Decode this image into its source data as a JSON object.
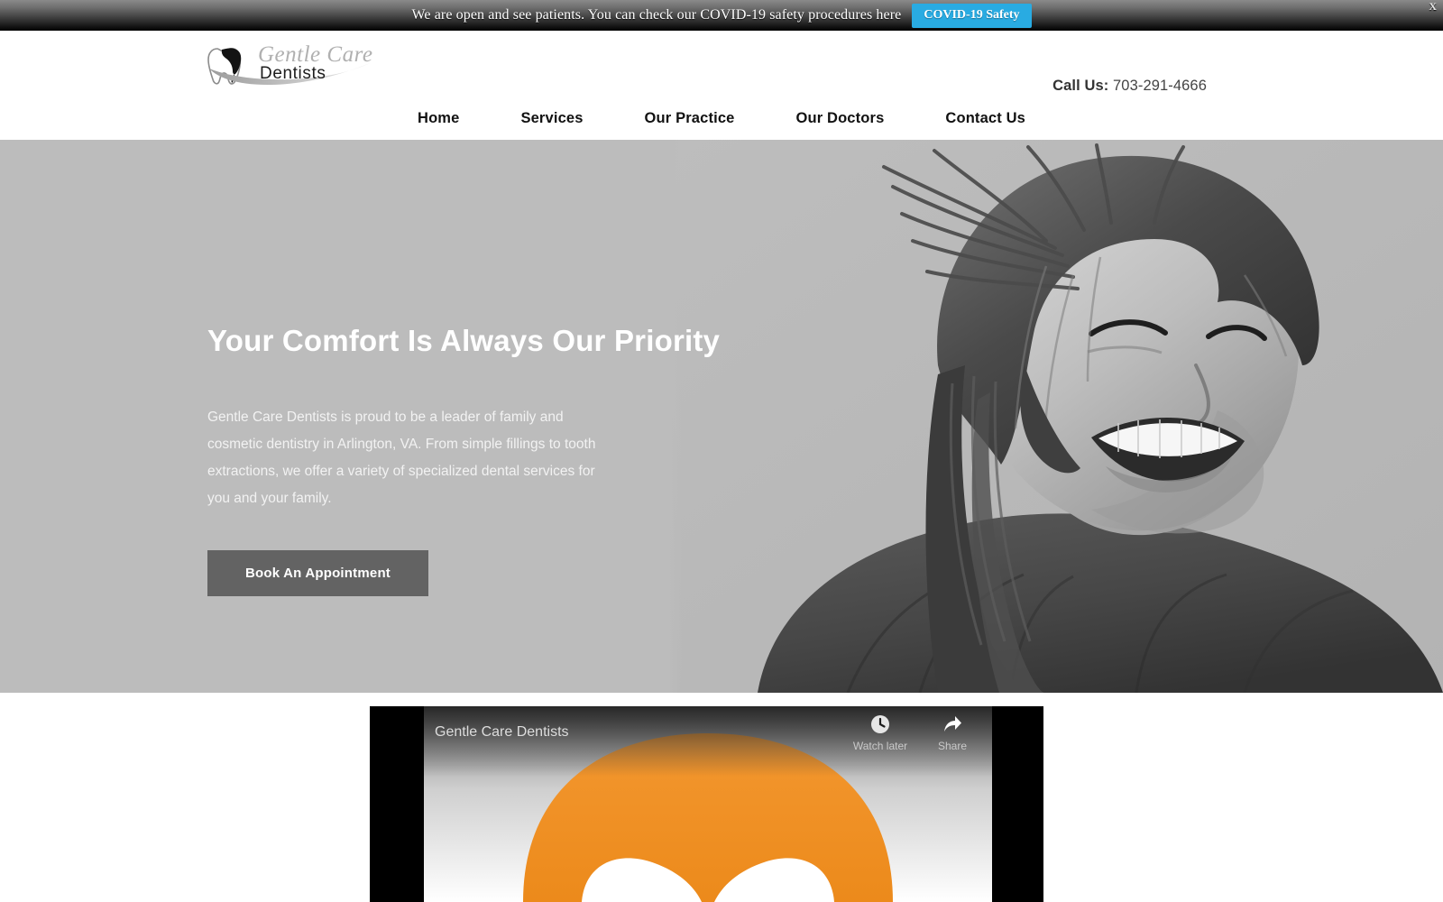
{
  "banner": {
    "message": "We are open and see patients. You can check our COVID-19 safety procedures here",
    "cta_label": "COVID-19 Safety",
    "close_label": "X",
    "cta_color": "#29abe2"
  },
  "header": {
    "logo": {
      "script_text": "Gentle Care",
      "sub_text": "Dentists",
      "icon": "tooth-icon"
    },
    "phone": {
      "label": "Call Us:",
      "number": "703-291-4666"
    },
    "nav": [
      {
        "label": "Home"
      },
      {
        "label": "Services"
      },
      {
        "label": "Our Practice"
      },
      {
        "label": "Our Doctors"
      },
      {
        "label": "Contact Us"
      }
    ]
  },
  "hero": {
    "title": "Your Comfort Is Always Our Priority",
    "paragraph": "Gentle Care Dentists is proud to be a leader of family and cosmetic dentistry in Arlington, VA. From simple fillings to tooth extractions, we offer a variety of specialized dental services for you and your family.",
    "cta_label": "Book An Appointment",
    "background_color": "#bcbcbc",
    "cta_color": "#636363"
  },
  "video": {
    "channel_title": "Gentle Care Dentists",
    "watch_later_label": "Watch later",
    "share_label": "Share",
    "accent_color": "#f29127"
  }
}
